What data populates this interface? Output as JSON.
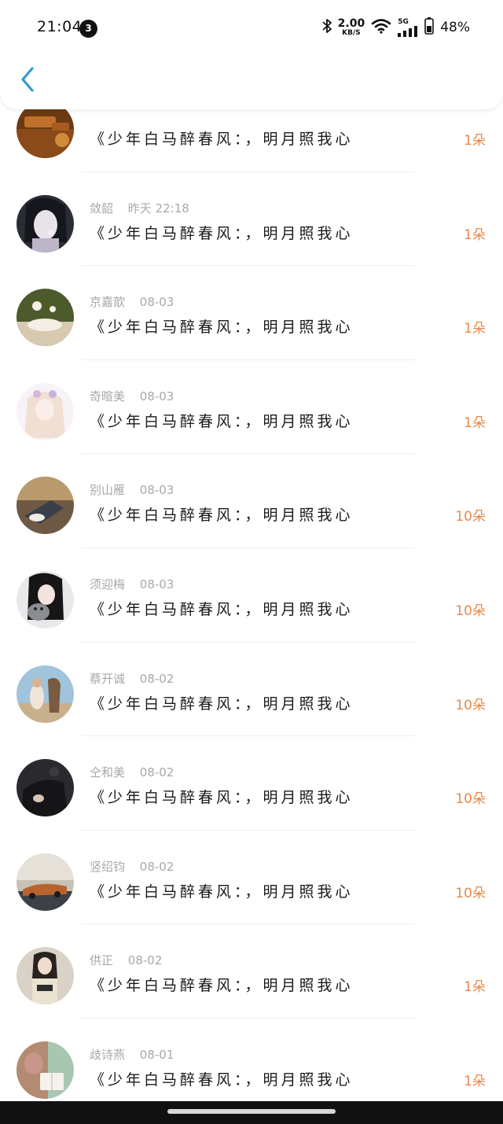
{
  "status_bar": {
    "time": "21:04",
    "notification_count": "3",
    "net_speed_value": "2.00",
    "net_speed_unit": "KB/S",
    "network_type": "5G",
    "battery_percent": "48%"
  },
  "nav": {
    "back_icon": "chevron-left-icon"
  },
  "colors": {
    "accent_blue": "#2d9cdb",
    "amount_orange": "#e8894a",
    "meta_gray": "#a8a8a8"
  },
  "rows": [
    {
      "name": "",
      "time": "",
      "message": "《少年白马醉春风：，明月照我心",
      "amount": "1朵"
    },
    {
      "name": "敛韶",
      "time": "昨天 22:18",
      "message": "《少年白马醉春风：，明月照我心",
      "amount": "1朵"
    },
    {
      "name": "京嘉歆",
      "time": "08-03",
      "message": "《少年白马醉春风：，明月照我心",
      "amount": "1朵"
    },
    {
      "name": "奇暄美",
      "time": "08-03",
      "message": "《少年白马醉春风：，明月照我心",
      "amount": "1朵"
    },
    {
      "name": "别山雁",
      "time": "08-03",
      "message": "《少年白马醉春风：，明月照我心",
      "amount": "10朵"
    },
    {
      "name": "须迎梅",
      "time": "08-03",
      "message": "《少年白马醉春风：，明月照我心",
      "amount": "10朵"
    },
    {
      "name": "蔡开诚",
      "time": "08-02",
      "message": "《少年白马醉春风：，明月照我心",
      "amount": "10朵"
    },
    {
      "name": "仝和美",
      "time": "08-02",
      "message": "《少年白马醉春风：，明月照我心",
      "amount": "10朵"
    },
    {
      "name": "竖绍钧",
      "time": "08-02",
      "message": "《少年白马醉春风：，明月照我心",
      "amount": "10朵"
    },
    {
      "name": "供正",
      "time": "08-02",
      "message": "《少年白马醉春风：，明月照我心",
      "amount": "1朵"
    },
    {
      "name": "歧诗燕",
      "time": "08-01",
      "message": "《少年白马醉春风：，明月照我心",
      "amount": "1朵"
    }
  ]
}
